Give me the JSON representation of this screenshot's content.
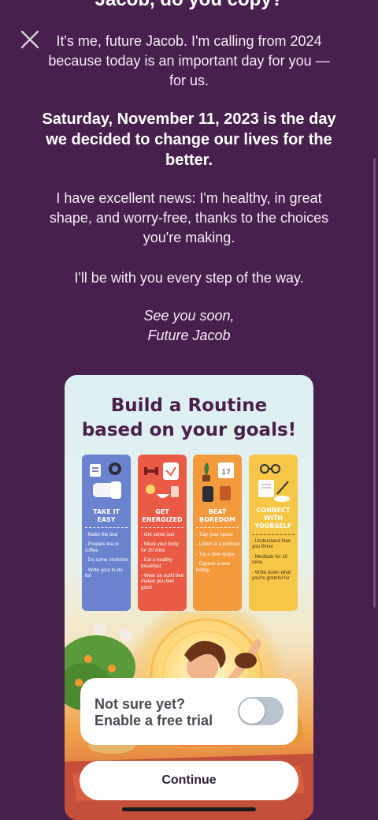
{
  "header": {
    "clipped_title": "Jacob, do you copy?"
  },
  "letter": {
    "p1": "It's me, future Jacob. I'm calling from 2024 because today is an important day for you — for us.",
    "p2": "Saturday, November 11, 2023 is the day we decided to change our lives for the better.",
    "p3": "I have excellent news: I'm healthy, in great shape, and worry-free, thanks to the choices you're making.",
    "p4": "I'll be with you every step of the way.",
    "sign1": "See you soon,",
    "sign2": "Future Jacob"
  },
  "card": {
    "title_line1": "Build a Routine",
    "title_line2": "based on your goals!",
    "columns": [
      {
        "head": "TAKE IT EASY",
        "items": [
          "- Make the bed",
          "- Prepare tea or coffee",
          "- Do some stretches",
          "- Write your to-do list"
        ],
        "color": "#6b82cf"
      },
      {
        "head": "GET ENERGIZED",
        "items": [
          "- Get some sun",
          "- Move your body for 20 mins",
          "- Eat a healthy breakfast",
          "- Wear an outfit that makes you feel good"
        ],
        "color": "#ea5b46"
      },
      {
        "head": "BEAT BOREDOM",
        "items": [
          "- Tidy your space",
          "- Listen to a podcast",
          "- Try a new recipe",
          "- Explore a new hobby"
        ],
        "color": "#f39a3c"
      },
      {
        "head": "CONNECT WITH YOURSELF",
        "items": [
          "- Understand how you thrive",
          "- Meditate for 10 mins",
          "- Write down what you're grateful for"
        ],
        "color": "#f6c646"
      }
    ]
  },
  "trial": {
    "line1": "Not sure yet?",
    "line2": "Enable a free trial",
    "enabled": false
  },
  "actions": {
    "continue_label": "Continue"
  },
  "icons": {
    "close": "close-icon"
  },
  "colors": {
    "background": "#48204d",
    "card_title": "#4a1f4d",
    "toggle_off": "#b9c4cf"
  }
}
